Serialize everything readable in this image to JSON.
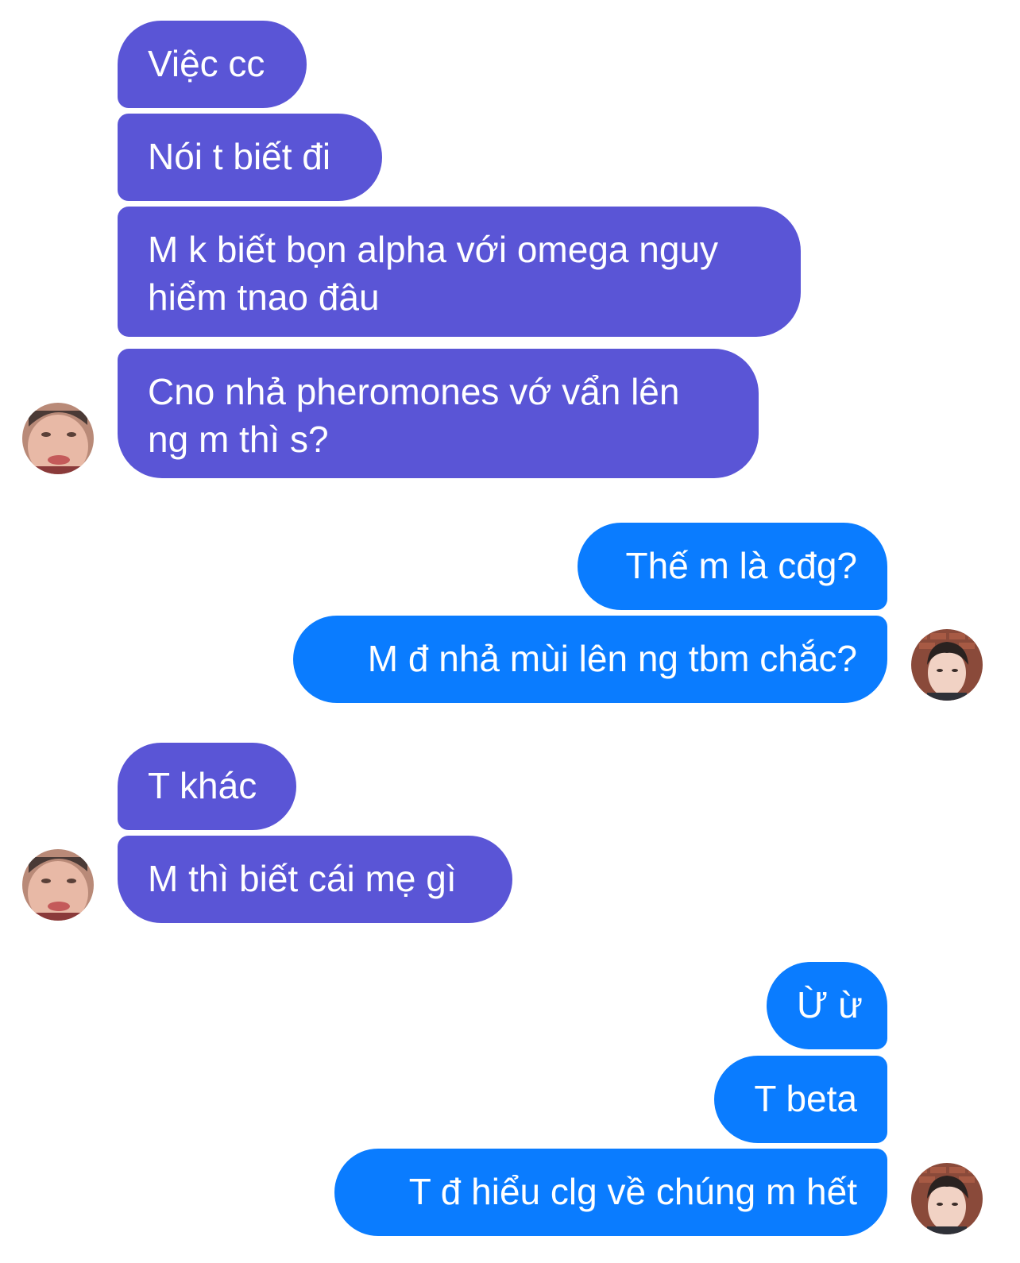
{
  "conversation": {
    "group1": [
      {
        "text": "Việc cc"
      },
      {
        "text": "Nói t biết đi"
      },
      {
        "text": "M k biết bọn alpha với omega nguy hiểm tnao đâu"
      },
      {
        "text": "Cno nhả pheromones vớ vẩn lên ng m thì s?"
      }
    ],
    "group2": [
      {
        "text": "Thế m là cđg?"
      },
      {
        "text": "M đ nhả mùi lên ng tbm chắc?"
      }
    ],
    "group3": [
      {
        "text": "T khác"
      },
      {
        "text": "M thì biết cái mẹ gì"
      }
    ],
    "group4": [
      {
        "text": "Ừ ừ"
      },
      {
        "text": "T beta"
      },
      {
        "text": "T đ hiểu clg về chúng m hết"
      }
    ]
  },
  "colors": {
    "incoming_bubble": "#5a55d6",
    "outgoing_bubble": "#0a7cff",
    "background": "#ffffff"
  },
  "avatars": {
    "other": "contact-avatar-photo",
    "self": "user-avatar-photo"
  }
}
